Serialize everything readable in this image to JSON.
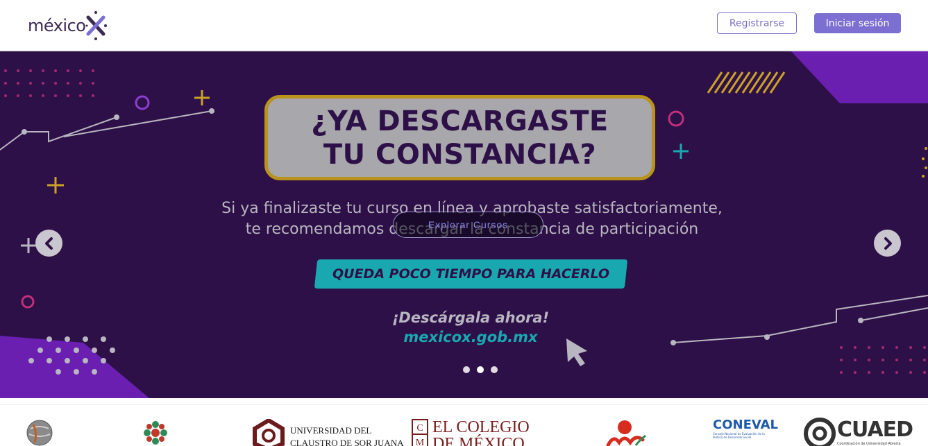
{
  "header": {
    "logo_text": "méxico",
    "register_label": "Registrarse",
    "login_label": "Iniciar sesión"
  },
  "hero": {
    "title_line1": "¿YA DESCARGASTE",
    "title_line2": "TU CONSTANCIA?",
    "subtitle_line1": "Si ya finalizaste tu curso en línea y aprobaste satisfactoriamente,",
    "subtitle_line2": "te recomendamos descargar la constancia de participación",
    "explore_label": "Explorar Cursos",
    "banner_text": "QUEDA POCO TIEMPO PARA HACERLO",
    "download_line1": "¡Descárgala ahora!",
    "download_line2": "mexicox.gob.mx",
    "slide_count": 3,
    "active_slide": 2
  },
  "partners": {
    "uni_line1": "UNIVERSIDAD DEL",
    "uni_line2": "CLAUSTRO DE SOR JUANA",
    "colegio_line1": "EL COLEGIO",
    "colegio_line2": "DE MÉXICO",
    "coneval_name": "CONEVAL",
    "coneval_caption": "Consejo Nacional de Evaluación de la Política de Desarrollo Social",
    "cuaed_name": "CUAED",
    "cuaed_caption": "Coordinación de Universidad Abierta"
  },
  "colors": {
    "brand_purple": "#7b6fd2",
    "hero_background": "#2e1048",
    "accent_teal": "#1aa8b0",
    "accent_gold": "#b8941e"
  }
}
